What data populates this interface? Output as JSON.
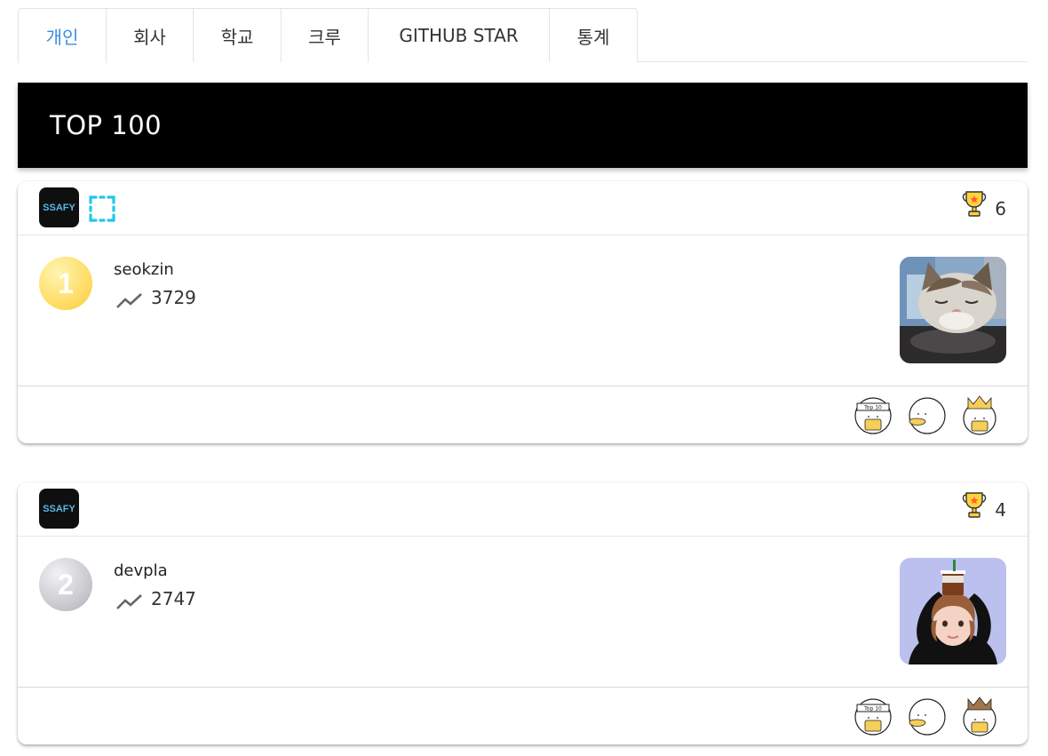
{
  "tabs": [
    {
      "label": "개인",
      "active": true
    },
    {
      "label": "회사",
      "active": false
    },
    {
      "label": "학교",
      "active": false
    },
    {
      "label": "크루",
      "active": false
    },
    {
      "label": "GITHUB STAR",
      "active": false
    },
    {
      "label": "통계",
      "active": false
    }
  ],
  "banner": {
    "title": "TOP 100"
  },
  "colors": {
    "active_tab": "#3b8fe4",
    "banner_bg": "#000000",
    "org_logo_text": "#55b9e6",
    "crew_icon": "#1ec8e8"
  },
  "users": [
    {
      "rank": "1",
      "rank_style": "gold",
      "username": "seokzin",
      "score": "3729",
      "trophies": "6",
      "org_logo": "SSAFY",
      "has_crew_icon": true,
      "avatar": "cat-photo",
      "badges": [
        "top10-badge",
        "duck-badge",
        "crown-badge"
      ]
    },
    {
      "rank": "2",
      "rank_style": "silver",
      "username": "devpla",
      "score": "2747",
      "trophies": "4",
      "org_logo": "SSAFY",
      "has_crew_icon": false,
      "avatar": "character-with-drink",
      "badges": [
        "top10-badge",
        "duck-badge",
        "crown-badge"
      ]
    }
  ],
  "badge_text": {
    "top10": "Top 10"
  }
}
